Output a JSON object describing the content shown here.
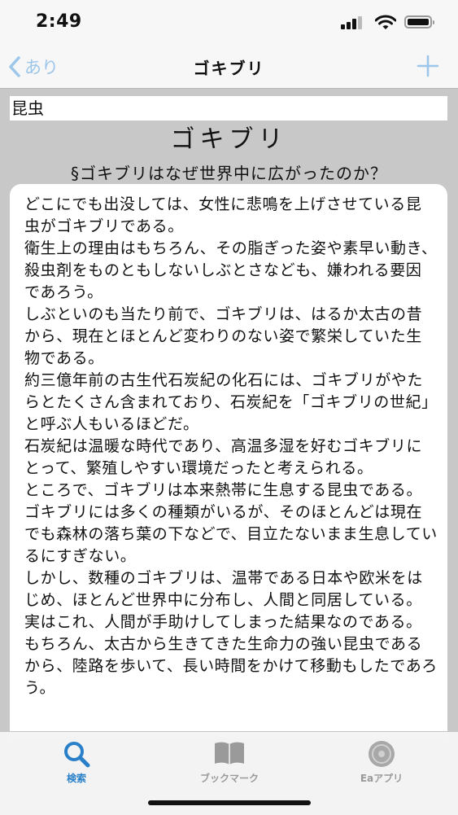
{
  "status": {
    "time": "2:49"
  },
  "nav": {
    "back_label": "あり",
    "title": "ゴキブリ"
  },
  "category": "昆虫",
  "article": {
    "title": "ゴキブリ",
    "subtitle": "§ゴキブリはなぜ世界中に広がったのか？",
    "body": "どこにでも出没しては、女性に悲鳴を上げさせている昆虫がゴキブリである。\n衛生上の理由はもちろん、その脂ぎった姿や素早い動き、殺虫剤をものともしないしぶとさなども、嫌われる要因であろう。\nしぶといのも当たり前で、ゴキブリは、はるか太古の昔から、現在とほとんど変わりのない姿で繁栄していた生物である。\n約三億年前の古生代石炭紀の化石には、ゴキブリがやたらとたくさん含まれており、石炭紀を「ゴキブリの世紀」と呼ぶ人もいるほどだ。\n石炭紀は温暖な時代であり、高温多湿を好むゴキブリにとって、繁殖しやすい環境だったと考えられる。\nところで、ゴキブリは本来熱帯に生息する昆虫である。\nゴキブリには多くの種類がいるが、そのほとんどは現在でも森林の落ち葉の下などで、目立たないまま生息しているにすぎない。\nしかし、数種のゴキブリは、温帯である日本や欧米をはじめ、ほとんど世界中に分布し、人間と同居している。\n実はこれ、人間が手助けしてしまった結果なのである。\nもちろん、太古から生きてきた生命力の強い昆虫であるから、陸路を歩いて、長い時間をかけて移動もしたであろう。"
  },
  "tabs": [
    {
      "label": "検索",
      "icon": "search-icon",
      "active": true
    },
    {
      "label": "ブックマーク",
      "icon": "book-icon",
      "active": false
    },
    {
      "label": "Eaアプリ",
      "icon": "ea-app-icon",
      "active": false
    }
  ],
  "colors": {
    "accent": "#2a80c8",
    "nav_tint": "#9cc6ea",
    "inactive": "#9a9a9a"
  }
}
